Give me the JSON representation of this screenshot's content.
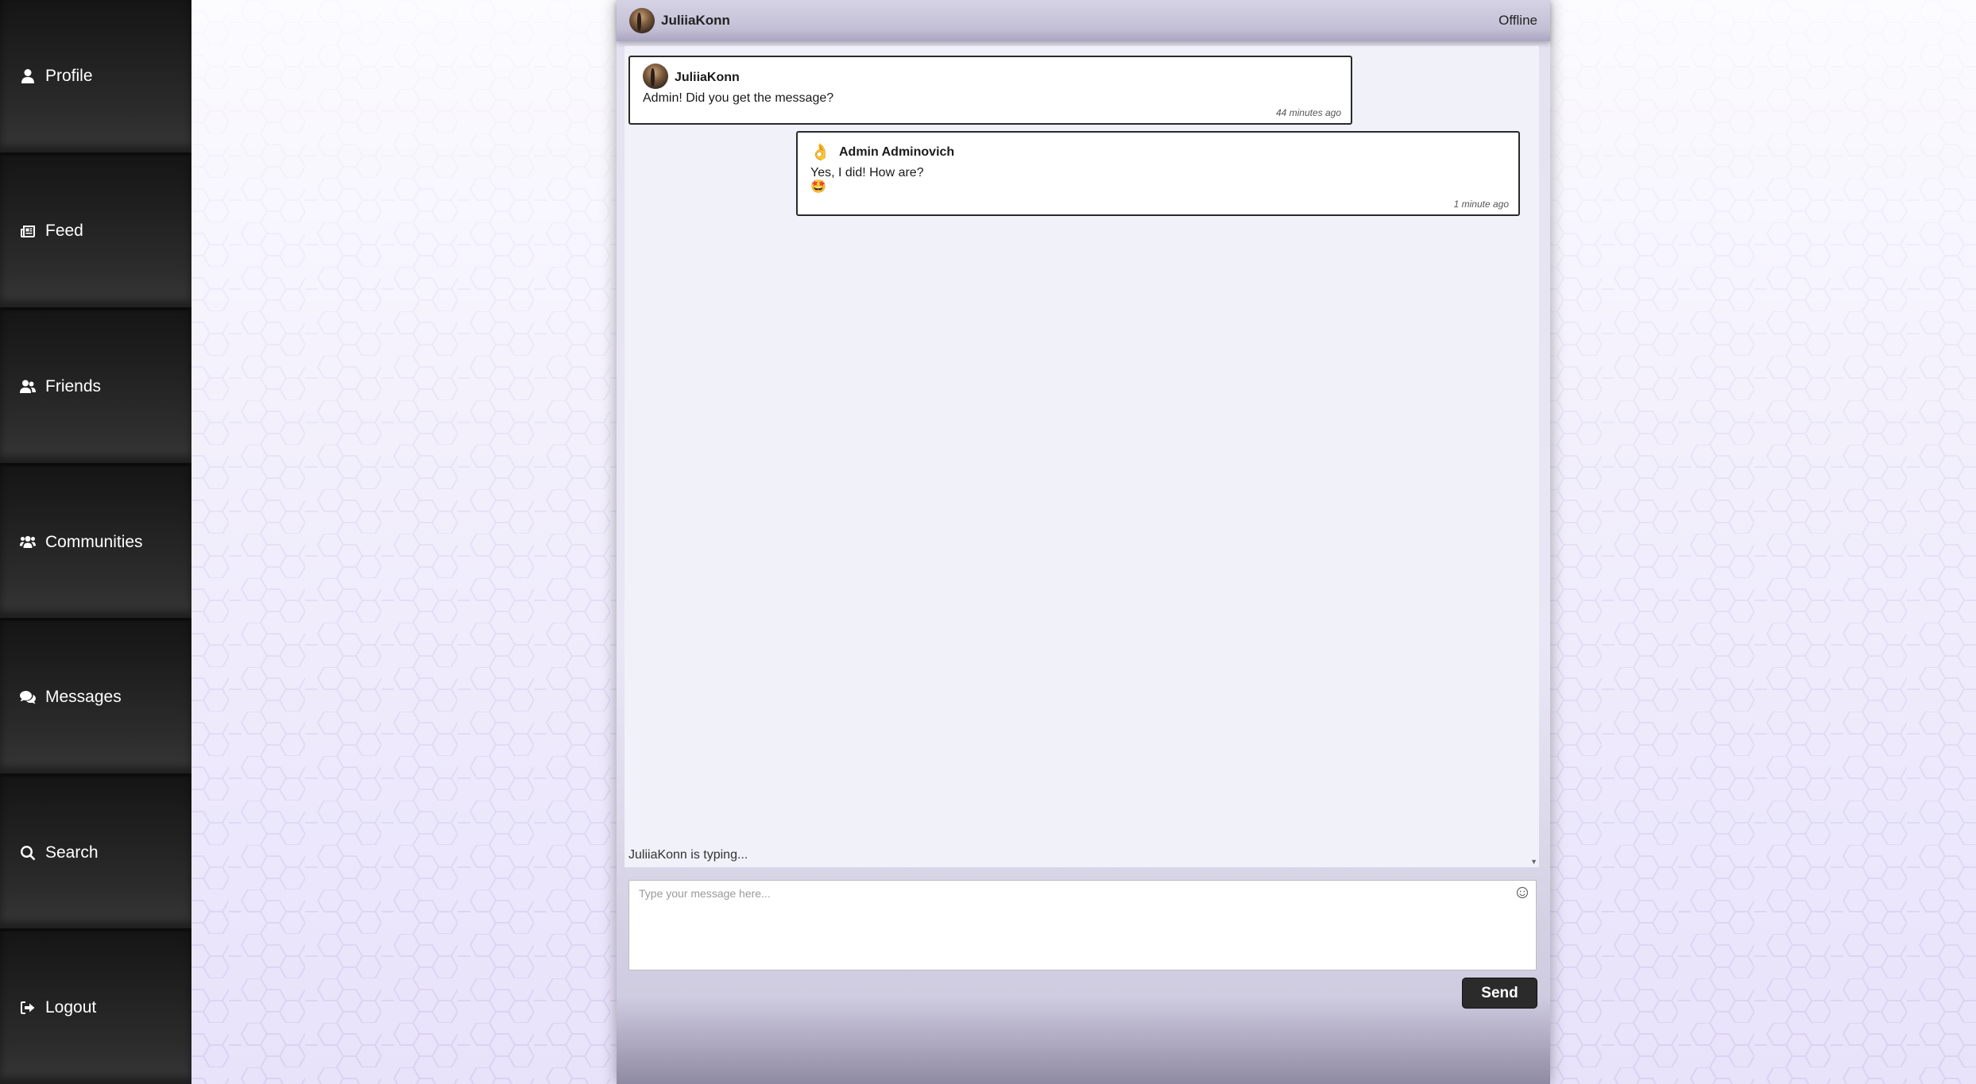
{
  "sidebar": {
    "items": [
      {
        "label": "Profile",
        "icon": "user-icon"
      },
      {
        "label": "Feed",
        "icon": "newspaper-icon"
      },
      {
        "label": "Friends",
        "icon": "user-friends-icon"
      },
      {
        "label": "Communities",
        "icon": "users-group-icon"
      },
      {
        "label": "Messages",
        "icon": "comments-icon"
      },
      {
        "label": "Search",
        "icon": "search-icon"
      },
      {
        "label": "Logout",
        "icon": "logout-icon"
      }
    ]
  },
  "chat": {
    "header": {
      "name": "JuliiaKonn",
      "status": "Offline"
    },
    "messages": [
      {
        "author": "JuliiaKonn",
        "text": "Admin! Did you get the message?",
        "time": "44 minutes ago"
      },
      {
        "author": "Admin Adminovich",
        "avatar_emoji": "👌",
        "text": "Yes, I did! How are?",
        "emoji": "🤩",
        "time": "1 minute ago"
      }
    ],
    "typing": "JuliiaKonn is typing...",
    "compose": {
      "placeholder": "Type your message here...",
      "send_label": "Send"
    }
  },
  "colors": {
    "sidebar_bg": "#1f1f1f",
    "panel_bg": "#f1f1f9",
    "send_button_bg": "#2b2b2b"
  }
}
